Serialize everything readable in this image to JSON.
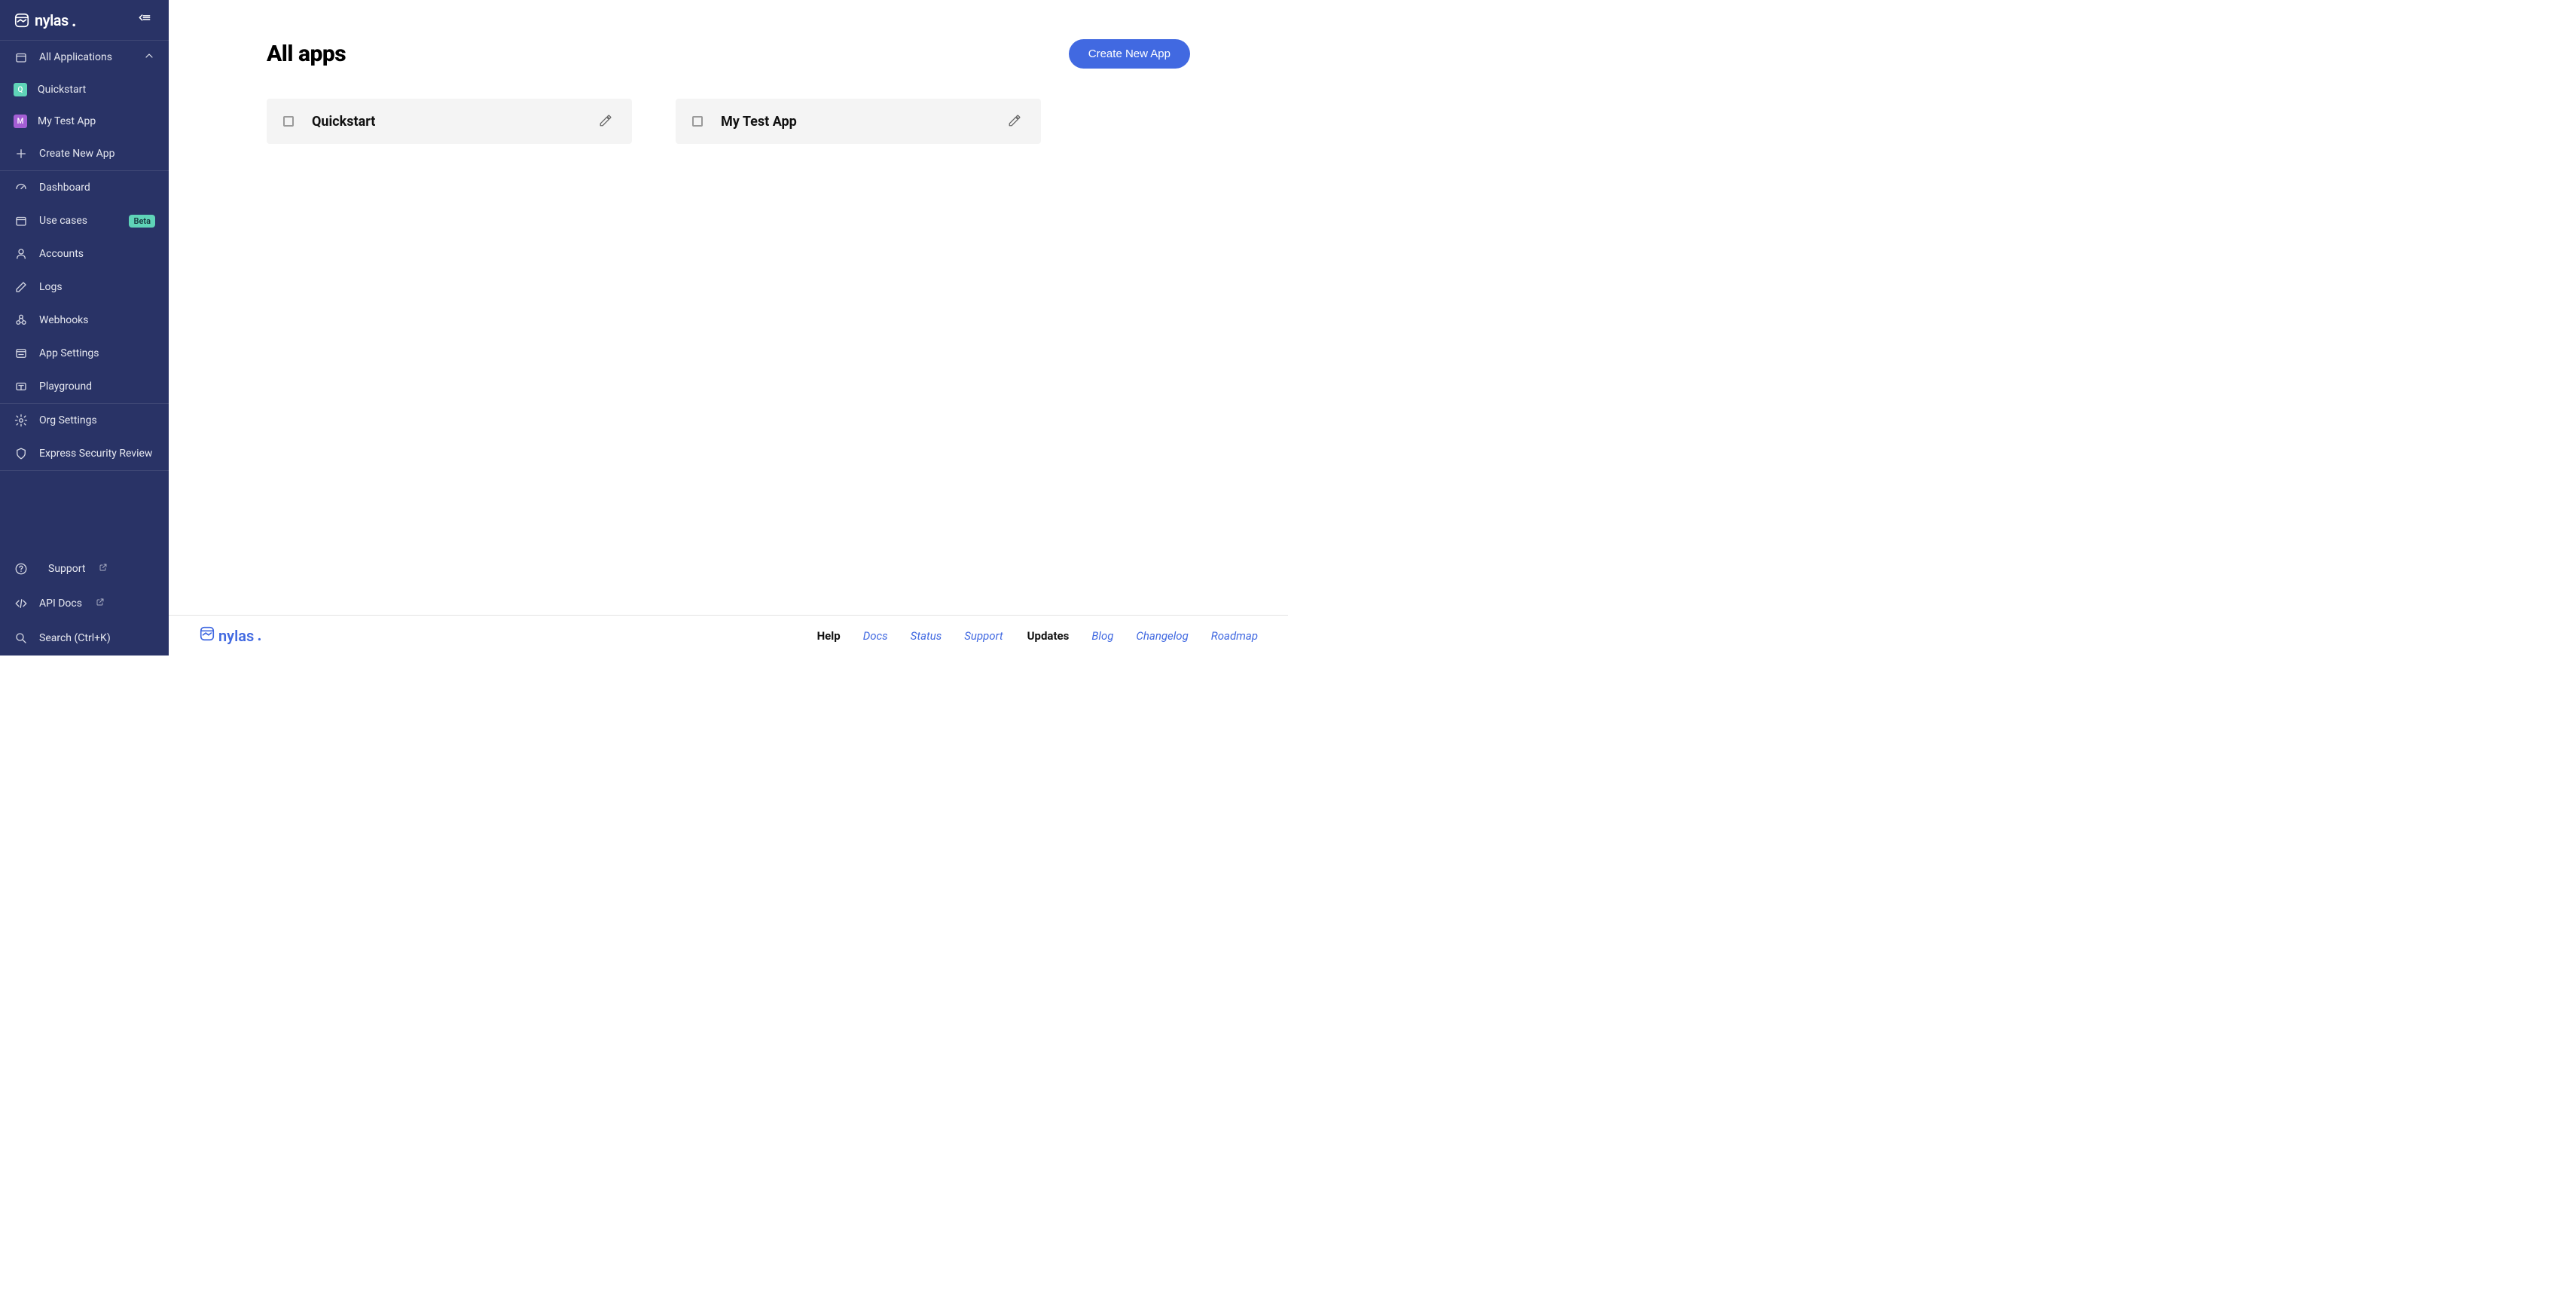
{
  "brand": "nylas",
  "sidebar": {
    "collapse_label": "Collapse",
    "all_applications": "All Applications",
    "apps": [
      {
        "initial": "Q",
        "label": "Quickstart"
      },
      {
        "initial": "M",
        "label": "My Test App"
      }
    ],
    "create_new_app": "Create New App",
    "nav": {
      "dashboard": "Dashboard",
      "use_cases": "Use cases",
      "use_cases_badge": "Beta",
      "accounts": "Accounts",
      "logs": "Logs",
      "webhooks": "Webhooks",
      "app_settings": "App Settings",
      "playground": "Playground"
    },
    "org": {
      "org_settings": "Org Settings",
      "security_review": "Express Security Review"
    },
    "bottom": {
      "support": "Support",
      "api_docs": "API Docs",
      "search": "Search (Ctrl+K)"
    }
  },
  "main": {
    "title": "All apps",
    "create_button": "Create New App",
    "apps": [
      {
        "name": "Quickstart"
      },
      {
        "name": "My Test App"
      }
    ]
  },
  "footer": {
    "help_label": "Help",
    "docs": "Docs",
    "status": "Status",
    "support": "Support",
    "updates_label": "Updates",
    "blog": "Blog",
    "changelog": "Changelog",
    "roadmap": "Roadmap"
  }
}
